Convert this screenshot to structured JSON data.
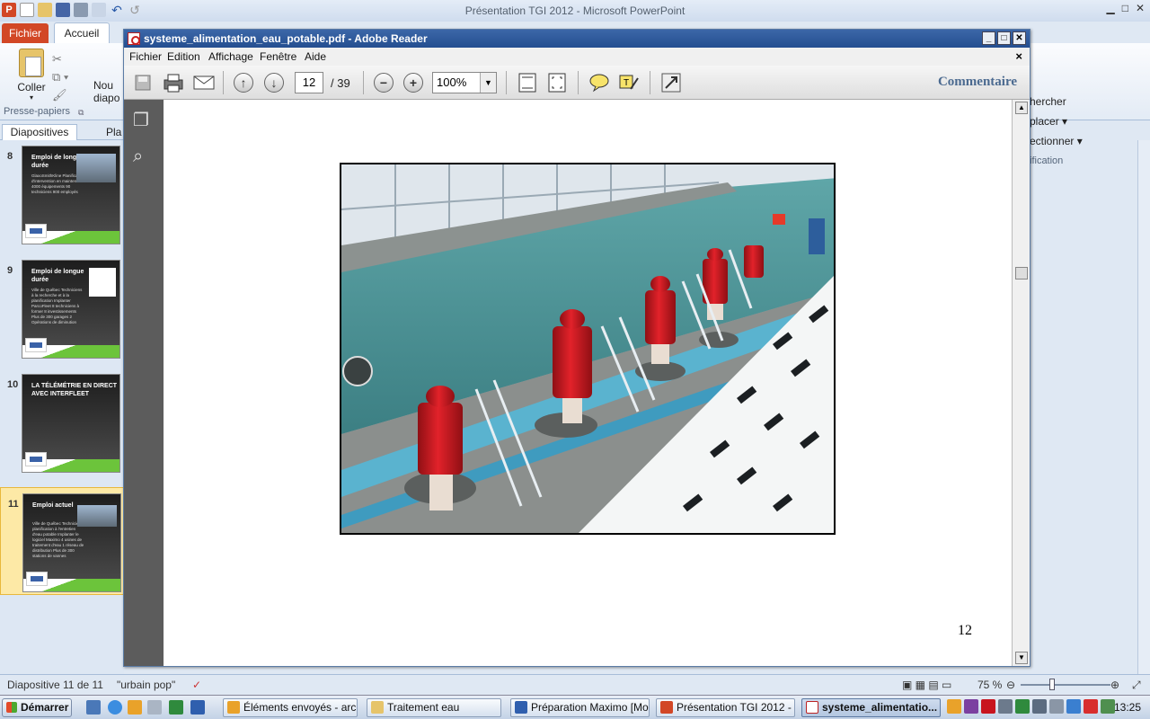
{
  "powerpoint": {
    "window_title": "Présentation TGI 2012 - Microsoft PowerPoint",
    "tabs": {
      "file": "Fichier",
      "home": "Accueil"
    },
    "ribbon": {
      "paste_label": "Coller",
      "new_slide_label_1": "Nou",
      "new_slide_label_2": "diapo",
      "clipboard_group": "Presse-papiers",
      "search": "hercher",
      "replace": "placer ▾",
      "select": "ectionner ▾",
      "editing_group": "ification"
    },
    "pane_tabs": {
      "slides": "Diapositives",
      "outline": "Pla"
    },
    "slides": [
      {
        "number": "8",
        "title": "Emploi de longue durée",
        "body": "GlaxoSmithKline Planification d'intervention en maintenance 4000 équipements 90 techniciens 900 employés"
      },
      {
        "number": "9",
        "title": "Emploi de longue durée",
        "body": "Ville de Québec Techniciens à la recherche et à la planification Implanter ParcoFleet 8 techniciens à former 8 investissements Plus de 300 garages 2 Opérations de diminution"
      },
      {
        "number": "10",
        "title": "LA TÉLÉMÉTRIE EN DIRECT AVEC INTERFLEET",
        "body": ""
      },
      {
        "number": "11",
        "title": "Emploi actuel",
        "body": "Ville de Québec Techniciens planification à l'entretien d'eau potable Implanter le logiciel Maximo 4 usines de traitement d'eau 1 réseau de distribution Plus de 300 stations de vannes"
      }
    ],
    "status": {
      "slide_counter": "Diapositive 11 de 11",
      "theme": "\"urbain pop\"",
      "zoom": "75 %"
    }
  },
  "reader": {
    "window_title": "systeme_alimentation_eau_potable.pdf - Adobe Reader",
    "menu": [
      "Fichier",
      "Edition",
      "Affichage",
      "Fenêtre",
      "Aide"
    ],
    "current_page": "12",
    "total_pages": "/ 39",
    "zoom": "100%",
    "comment_label": "Commentaire",
    "page_footer_number": "12"
  },
  "taskbar": {
    "start_label": "Démarrer",
    "tasks": [
      "Éléments envoyés - arc...",
      "Traitement eau",
      "Préparation Maximo [Mo...",
      "Présentation TGI 2012 - ...",
      "systeme_alimentatio..."
    ],
    "clock": "13:25"
  },
  "colors": {
    "ppt_accent": "#d24726",
    "reader_title": "#2a5597",
    "slide_selected": "#fde9a6",
    "pump_red": "#c8141e"
  }
}
